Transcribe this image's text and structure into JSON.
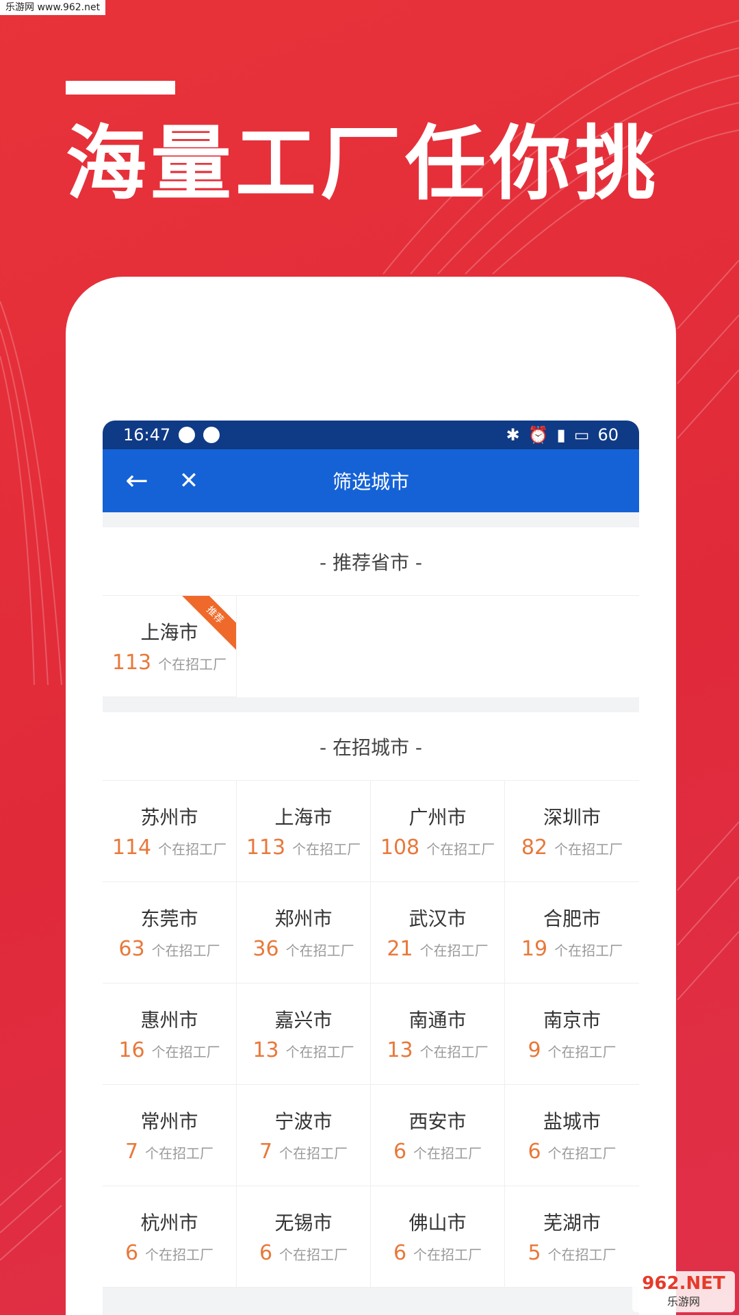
{
  "watermark_top": "乐游网 www.962.net",
  "headline": "海量工厂任你挑",
  "statusbar": {
    "time": "16:47",
    "battery": "60"
  },
  "appbar": {
    "back": "←",
    "close": "✕",
    "title": "筛选城市"
  },
  "recommended": {
    "title": "- 推荐省市 -",
    "items": [
      {
        "city": "上海市",
        "count": "113",
        "label": "个在招工厂",
        "badge": "推荐"
      }
    ]
  },
  "hiring": {
    "title": "- 在招城市 -",
    "items": [
      {
        "city": "苏州市",
        "count": "114",
        "label": "个在招工厂"
      },
      {
        "city": "上海市",
        "count": "113",
        "label": "个在招工厂"
      },
      {
        "city": "广州市",
        "count": "108",
        "label": "个在招工厂"
      },
      {
        "city": "深圳市",
        "count": "82",
        "label": "个在招工厂"
      },
      {
        "city": "东莞市",
        "count": "63",
        "label": "个在招工厂"
      },
      {
        "city": "郑州市",
        "count": "36",
        "label": "个在招工厂"
      },
      {
        "city": "武汉市",
        "count": "21",
        "label": "个在招工厂"
      },
      {
        "city": "合肥市",
        "count": "19",
        "label": "个在招工厂"
      },
      {
        "city": "惠州市",
        "count": "16",
        "label": "个在招工厂"
      },
      {
        "city": "嘉兴市",
        "count": "13",
        "label": "个在招工厂"
      },
      {
        "city": "南通市",
        "count": "13",
        "label": "个在招工厂"
      },
      {
        "city": "南京市",
        "count": "9",
        "label": "个在招工厂"
      },
      {
        "city": "常州市",
        "count": "7",
        "label": "个在招工厂"
      },
      {
        "city": "宁波市",
        "count": "7",
        "label": "个在招工厂"
      },
      {
        "city": "西安市",
        "count": "6",
        "label": "个在招工厂"
      },
      {
        "city": "盐城市",
        "count": "6",
        "label": "个在招工厂"
      },
      {
        "city": "杭州市",
        "count": "6",
        "label": "个在招工厂"
      },
      {
        "city": "无锡市",
        "count": "6",
        "label": "个在招工厂"
      },
      {
        "city": "佛山市",
        "count": "6",
        "label": "个在招工厂"
      },
      {
        "city": "芜湖市",
        "count": "5",
        "label": "个在招工厂"
      }
    ]
  },
  "watermark_bottom": {
    "big": "962.NET",
    "small": "乐游网"
  }
}
